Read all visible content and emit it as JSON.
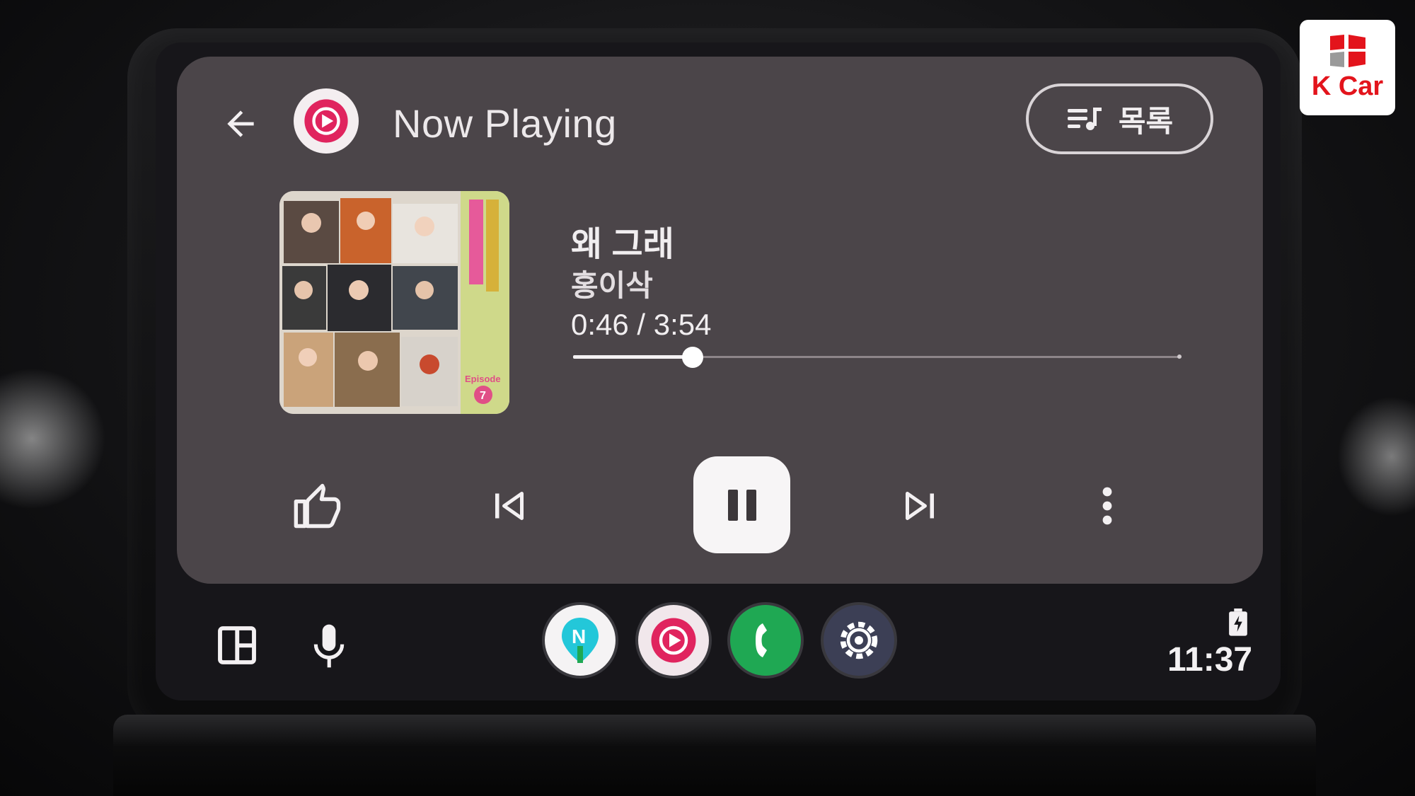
{
  "header": {
    "title": "Now Playing",
    "back_icon": "arrow-left-icon",
    "app_icon": "youtube-music-icon",
    "queue_button": {
      "label": "목록",
      "icon": "queue-music-icon"
    }
  },
  "track": {
    "title": "왜 그래",
    "artist": "홍이삭",
    "time_display": "0:46 / 3:54",
    "position_seconds": 46,
    "duration_seconds": 234,
    "album_art": {
      "side_text": "Episode",
      "badge": "7"
    }
  },
  "controls": {
    "like_icon": "thumbs-up-icon",
    "previous_icon": "skip-previous-icon",
    "play_pause_icon": "pause-icon",
    "next_icon": "skip-next-icon",
    "more_icon": "more-vertical-icon"
  },
  "taskbar": {
    "dashboard_icon": "dashboard-icon",
    "mic_icon": "microphone-icon",
    "apps": [
      {
        "name": "naver-map",
        "icon": "naver-map-icon",
        "letter": "N"
      },
      {
        "name": "youtube-music",
        "icon": "youtube-music-icon"
      },
      {
        "name": "phone",
        "icon": "phone-icon"
      },
      {
        "name": "settings",
        "icon": "settings-icon"
      }
    ],
    "clock": "11:37",
    "battery_icon": "battery-charging-icon"
  },
  "watermark": {
    "text": "K Car"
  },
  "colors": {
    "card_bg": "#4b4549",
    "music_accent": "#e0245e",
    "phone_green": "#1fa853",
    "kcar_red": "#e3141c"
  }
}
